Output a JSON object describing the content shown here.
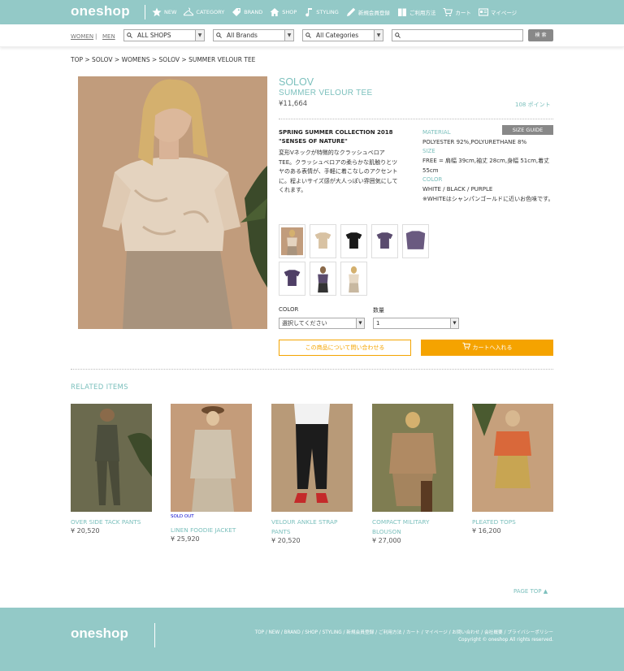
{
  "header": {
    "logo": "oneshop",
    "nav": [
      {
        "label": "NEW",
        "icon": "star-icon"
      },
      {
        "label": "CATEGORY",
        "icon": "hanger-icon"
      },
      {
        "label": "BRAND",
        "icon": "tag-icon"
      },
      {
        "label": "SHOP",
        "icon": "house-icon"
      },
      {
        "label": "STYLING",
        "icon": "note-icon"
      },
      {
        "label": "新規会員登録",
        "icon": "pen-icon"
      },
      {
        "label": "ご利用方法",
        "icon": "book-icon"
      },
      {
        "label": "カート",
        "icon": "cart-icon"
      },
      {
        "label": "マイページ",
        "icon": "card-icon"
      }
    ]
  },
  "search": {
    "gender_women": "WOMEN",
    "gender_sep": "|",
    "gender_men": "MEN",
    "shops": "ALL SHOPS",
    "brands": "All Brands",
    "categories": "All Categories",
    "query": "",
    "button": "検 索"
  },
  "breadcrumb": "TOP > SOLOV > WOMENS > SOLOV > SUMMER VELOUR TEE",
  "product": {
    "brand": "SOLOV",
    "name": "SUMMER VELOUR TEE",
    "price": "¥11,664",
    "points": "108 ポイント",
    "collection": "SPRING SUMMER COLLECTION 2018",
    "subtitle": "\"SENSES OF NATURE\"",
    "description": "変形Vネックが特徴的なクラッシュベロアTEE。クラッシュベロアの柔らかな肌触りとツヤのある表情が、手軽に着こなしのアクセントに。程よいサイズ感が大人っぽい雰囲気にしてくれます。",
    "size_guide": "SIZE GUIDE",
    "material_label": "MATERIAL",
    "material": "POLYESTER 92%,POLYURETHANE 8%",
    "size_label": "SIZE",
    "size": "FREE = 肩幅 39cm,袖丈 28cm,身幅 51cm,着丈 55cm",
    "color_label": "COLOR",
    "colors": "WHITE / BLACK / PURPLE",
    "color_note": "※WHITEはシャンパンゴールドに近いお色味です。",
    "color_select_label": "COLOR",
    "color_select_value": "選択してください",
    "qty_label": "数量",
    "qty_value": "1",
    "inquiry_button": "この商品について問い合わせる",
    "cart_button": "カートへ入れる"
  },
  "related": {
    "title": "RELATED ITEMS",
    "items": [
      {
        "name": "OVER SIDE TACK PANTS",
        "price": "¥ 20,520",
        "sold_out": ""
      },
      {
        "name": "LINEN FOODIE JACKET",
        "price": "¥ 25,920",
        "sold_out": "SOLD OUT"
      },
      {
        "name": "VELOUR ANKLE STRAP PANTS",
        "price": "¥ 20,520",
        "sold_out": ""
      },
      {
        "name": "COMPACT MILITARY BLOUSON",
        "price": "¥ 27,000",
        "sold_out": ""
      },
      {
        "name": "PLEATED TOPS",
        "price": "¥ 16,200",
        "sold_out": ""
      }
    ]
  },
  "page_top": "PAGE TOP ▲",
  "footer": {
    "logo": "oneshop",
    "links": "TOP / NEW / BRAND / SHOP / STYLING / 新規会員登録 / ご利用方法 / カート / マイページ / お問い合わせ / 会社概要 / プライバシーポリシー",
    "copyright": "Copyright © oneshop All rights reserved."
  }
}
